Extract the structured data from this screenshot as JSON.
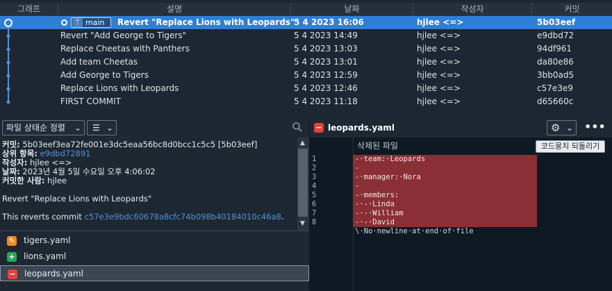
{
  "columns": {
    "graph": "그래프",
    "description": "설명",
    "date": "날짜",
    "author": "작성자",
    "commit": "커밋"
  },
  "branch": {
    "name": "main",
    "icon": "branch-icon"
  },
  "commits": [
    {
      "description": "Revert \"Replace Lions with Leopards\"",
      "date": "5 4 2023 16:06",
      "author": "hjlee <=>",
      "hash": "5b03eef"
    },
    {
      "description": "Revert \"Add George to Tigers\"",
      "date": "5 4 2023 14:49",
      "author": "hjlee <=>",
      "hash": "e9dbd72"
    },
    {
      "description": "Replace Cheetas with Panthers",
      "date": "5 4 2023 13:03",
      "author": "hjlee <=>",
      "hash": "94df961"
    },
    {
      "description": "Add team Cheetas",
      "date": "5 4 2023 13:01",
      "author": "hjlee <=>",
      "hash": "da80e86"
    },
    {
      "description": "Add George to Tigers",
      "date": "5 4 2023 12:59",
      "author": "hjlee <=>",
      "hash": "3bb0ad5"
    },
    {
      "description": "Replace Lions with Leopards",
      "date": "5 4 2023 12:46",
      "author": "hjlee <=>",
      "hash": "c57e3e9"
    },
    {
      "description": "FIRST COMMIT",
      "date": "5 4 2023 11:18",
      "author": "hjlee <=>",
      "hash": "d65660c"
    }
  ],
  "toolbar": {
    "sort_label": "파일 상태순 정렬",
    "chevron": "⌄",
    "list_icon": "☰"
  },
  "detail": {
    "commit_label": "커밋:",
    "commit_value": "5b03eef3ea72fe001e3dc5eaa56bc8d0bcc1c5c5 [5b03eef]",
    "parent_label": "상위 항목:",
    "parent_value": "e9dbd72891",
    "author_label": "작성자:",
    "author_value": "hjlee <=>",
    "date_label": "날짜:",
    "date_value": "2023년 4월 5일 수요일 오후 4:06:02",
    "committer_label": "커밋한 사람:",
    "committer_value": "hjlee",
    "message_title": "Revert \"Replace Lions with Leopards\"",
    "message_body_prefix": "This reverts commit ",
    "message_body_link": "c57e3e9bdc60678a8cfc74b098b40184010c46a8",
    "message_body_suffix": "."
  },
  "files": [
    {
      "name": "tigers.yaml",
      "status": "modified",
      "glyph": "✎"
    },
    {
      "name": "lions.yaml",
      "status": "added",
      "glyph": "+"
    },
    {
      "name": "leopards.yaml",
      "status": "removed",
      "glyph": "−"
    }
  ],
  "diff": {
    "file_name": "leopards.yaml",
    "file_glyph": "−",
    "hunk_label": "삭제된 파일",
    "discard_label": "코드뭉치 되돌리기",
    "more_label": "•••",
    "lines": [
      {
        "num": "1",
        "text": "-·team:·Leopards",
        "kind": "rem"
      },
      {
        "num": "2",
        "text": "-",
        "kind": "rem"
      },
      {
        "num": "3",
        "text": "-·manager:·Nora",
        "kind": "rem"
      },
      {
        "num": "4",
        "text": "-",
        "kind": "rem"
      },
      {
        "num": "5",
        "text": "-·members:",
        "kind": "rem"
      },
      {
        "num": "6",
        "text": "-·-·Linda",
        "kind": "rem"
      },
      {
        "num": "7",
        "text": "-·-·William",
        "kind": "rem"
      },
      {
        "num": "8",
        "text": "-·-·David",
        "kind": "rem"
      },
      {
        "num": "",
        "text": "\\·No·newline·at·end·of·file",
        "kind": "plain"
      }
    ]
  },
  "colors": {
    "selection": "#2e7fd6",
    "removed": "#8a2f35",
    "added": "#2aa65a",
    "modified": "#ef8b1c"
  }
}
